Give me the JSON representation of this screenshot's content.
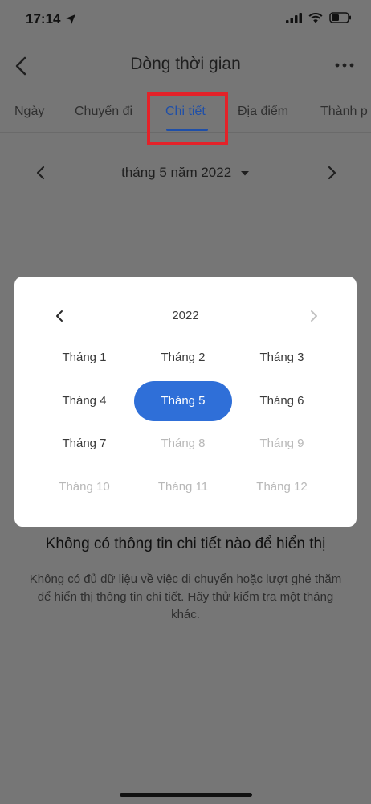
{
  "status_bar": {
    "time": "17:14"
  },
  "header": {
    "title": "Dòng thời gian"
  },
  "tabs": [
    {
      "label": "Ngày"
    },
    {
      "label": "Chuyến đi"
    },
    {
      "label": "Chi tiết"
    },
    {
      "label": "Địa điểm"
    },
    {
      "label": "Thành p"
    }
  ],
  "active_tab": "Chi tiết",
  "month_nav": {
    "label": "tháng 5 năm 2022"
  },
  "picker": {
    "year": "2022",
    "months": [
      {
        "label": "Tháng 1",
        "state": "enabled"
      },
      {
        "label": "Tháng 2",
        "state": "enabled"
      },
      {
        "label": "Tháng 3",
        "state": "enabled"
      },
      {
        "label": "Tháng 4",
        "state": "enabled"
      },
      {
        "label": "Tháng 5",
        "state": "selected"
      },
      {
        "label": "Tháng 6",
        "state": "enabled"
      },
      {
        "label": "Tháng 7",
        "state": "enabled"
      },
      {
        "label": "Tháng 8",
        "state": "disabled"
      },
      {
        "label": "Tháng 9",
        "state": "disabled"
      },
      {
        "label": "Tháng 10",
        "state": "disabled"
      },
      {
        "label": "Tháng 11",
        "state": "disabled"
      },
      {
        "label": "Tháng 12",
        "state": "disabled"
      }
    ]
  },
  "empty_state": {
    "title": "Không có thông tin chi tiết nào để hiển thị",
    "body": "Không có đủ dữ liệu về việc di chuyển hoặc lượt ghé thăm để hiển thị thông tin chi tiết. Hãy thử kiểm tra một tháng khác."
  },
  "colors": {
    "accent": "#2f6fd8",
    "tab_active": "#1f4fa8",
    "highlight": "#e32229",
    "overlay_bg": "#767676"
  }
}
